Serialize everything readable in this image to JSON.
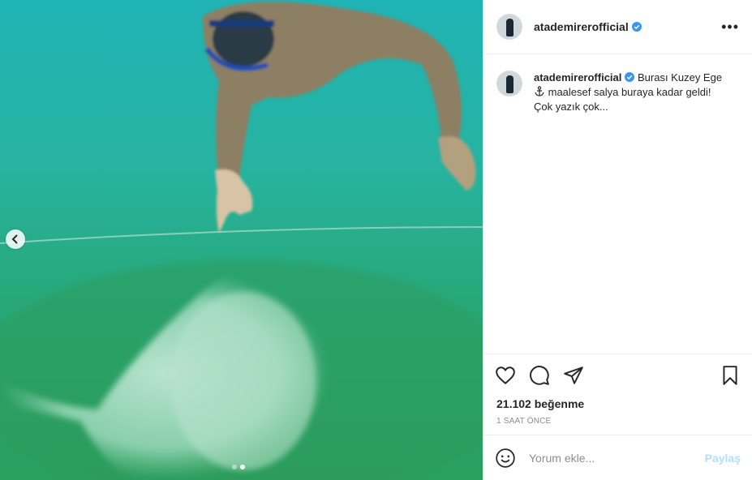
{
  "post": {
    "username": "atademirerofficial",
    "verified": true,
    "caption_lines": [
      "Burası Kuzey Ege",
      "maalesef salya buraya kadar geldi!",
      "Çok yazık çok..."
    ],
    "caption_emoji": "anchor-icon",
    "likes": "21.102 beğenme",
    "time": "1 SAAT ÖNCE",
    "comment_placeholder": "Yorum ekle...",
    "share_label": "Paylaş",
    "carousel": {
      "total": 2,
      "active_index": 2
    },
    "colors": {
      "water": "#27b3a0",
      "seabed": "#2aa36c",
      "verified": "#3897f0",
      "share_disabled": "#b2dffc"
    }
  }
}
